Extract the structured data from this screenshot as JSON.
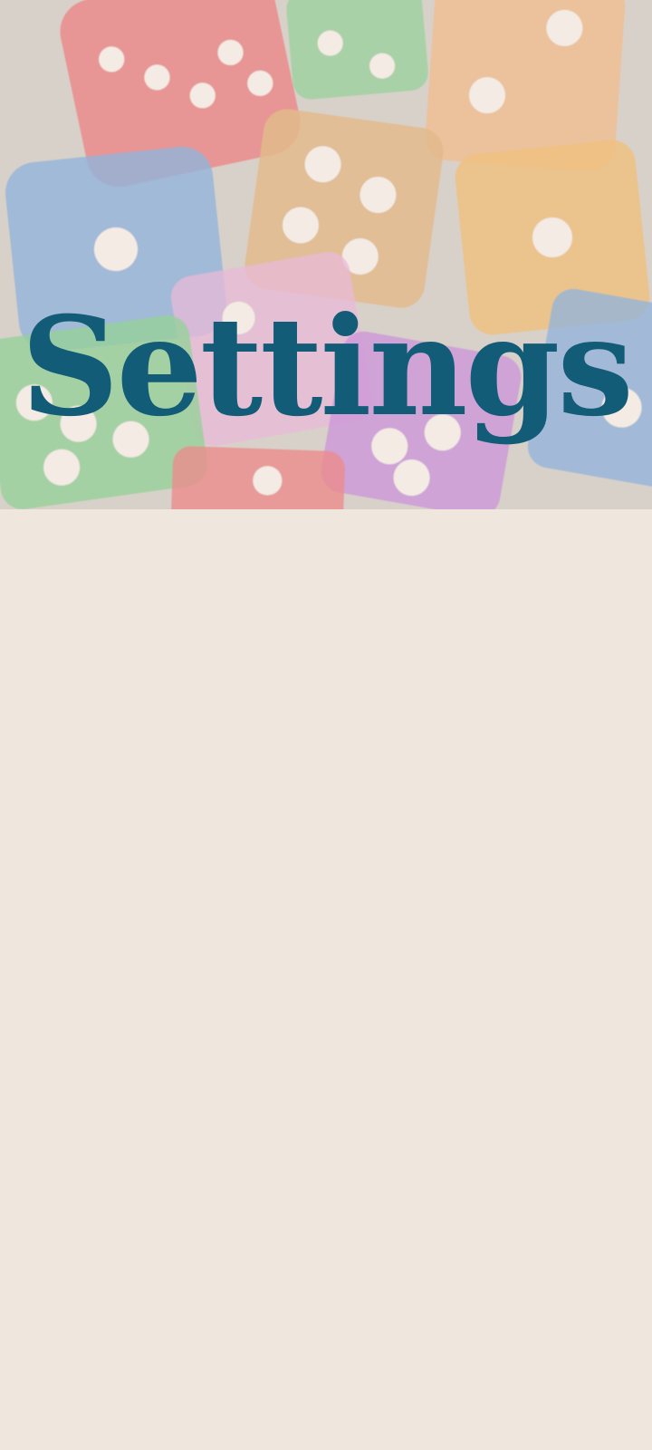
{
  "page": {
    "title": "Settings"
  },
  "colors": {
    "background": "#efe6de",
    "title": "#125c78",
    "dice": [
      "#e84a52",
      "#4f8fd8",
      "#f2a15a",
      "#57c06a",
      "#e59ad4",
      "#b45fd6",
      "#f0a53a"
    ]
  },
  "hero": {
    "icon": "dice-pattern"
  }
}
